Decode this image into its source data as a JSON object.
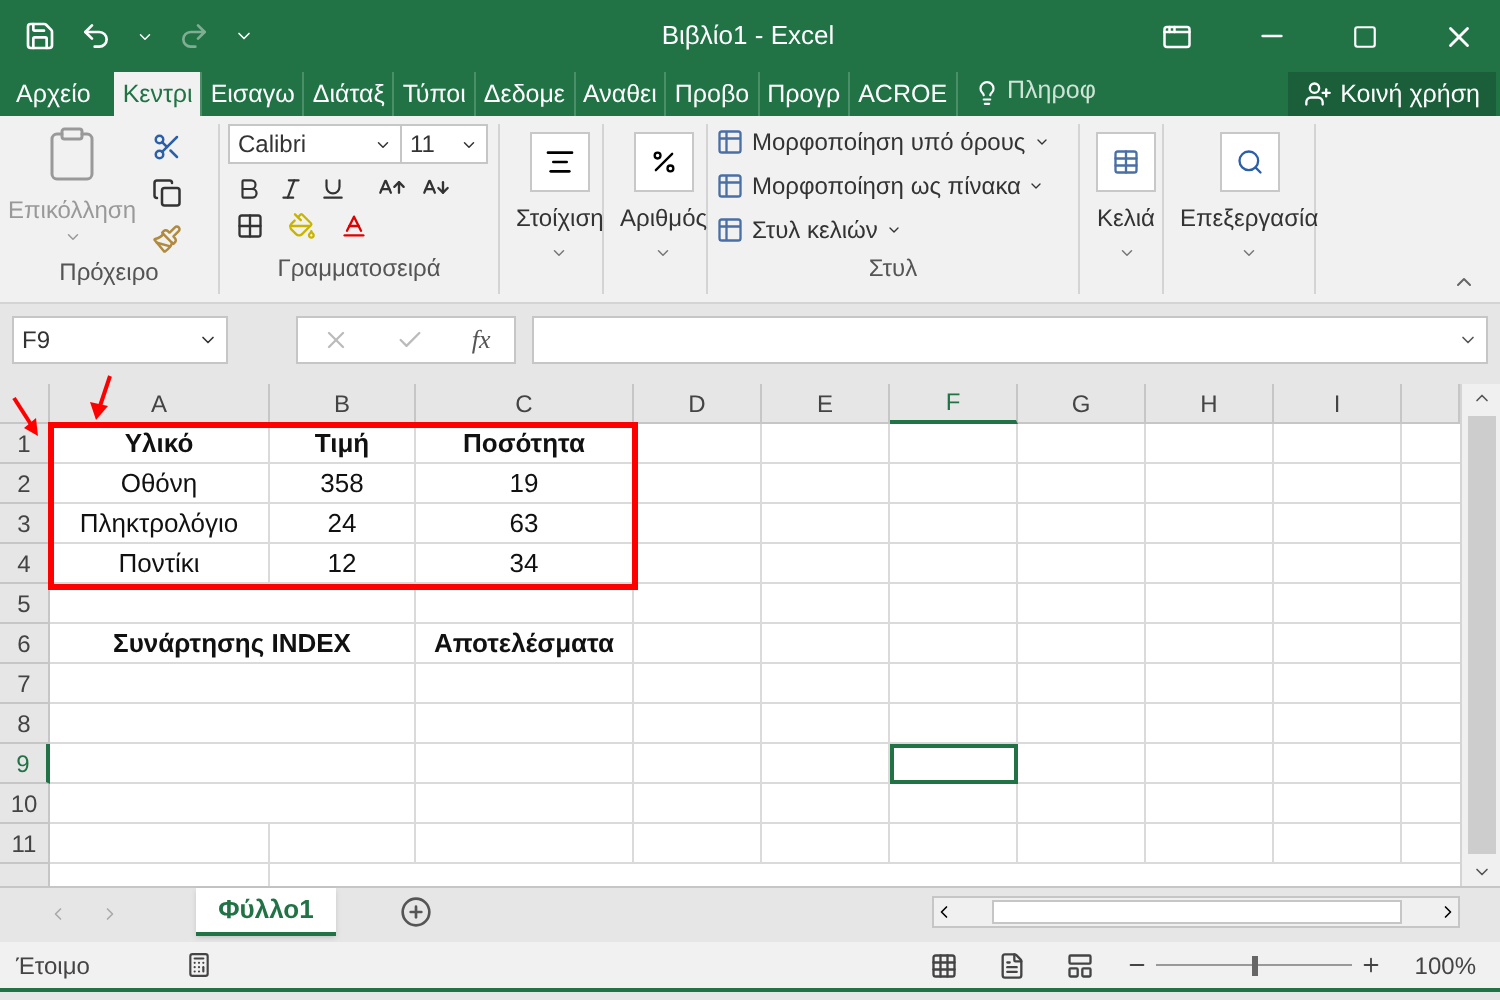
{
  "title_bar": {
    "title": "Βιβλίο1 - Excel"
  },
  "ribbon_tabs": [
    {
      "label": "Αρχείο",
      "kind": "file",
      "selected": false
    },
    {
      "label": "Κεντρι",
      "kind": "tab",
      "selected": true
    },
    {
      "label": "Εισαγω",
      "kind": "tab",
      "selected": false
    },
    {
      "label": "Διάταξ",
      "kind": "tab",
      "selected": false
    },
    {
      "label": "Τύποι",
      "kind": "tab",
      "selected": false
    },
    {
      "label": "Δεδομε",
      "kind": "tab",
      "selected": false
    },
    {
      "label": "Αναθει",
      "kind": "tab",
      "selected": false
    },
    {
      "label": "Προβο",
      "kind": "tab",
      "selected": false
    },
    {
      "label": "Προγρ",
      "kind": "tab",
      "selected": false
    },
    {
      "label": "ACROE",
      "kind": "tab",
      "selected": false
    }
  ],
  "tell_me": "Πληροφ",
  "share": "Κοινή χρήση",
  "clipboard": {
    "paste": "Επικόλληση",
    "paste_disabled": true,
    "label": "Πρόχειρο"
  },
  "font": {
    "name": "Calibri",
    "size": "11",
    "label": "Γραμματοσειρά"
  },
  "alignment": {
    "label": "Στοίχιση"
  },
  "number": {
    "label": "Αριθμός"
  },
  "styles": {
    "items": [
      "Μορφοποίηση υπό όρους",
      "Μορφοποίηση ως πίνακα",
      "Στυλ κελιών"
    ],
    "label": "Στυλ"
  },
  "cells": {
    "label": "Κελιά"
  },
  "editing": {
    "label": "Επεξεργασία"
  },
  "name_box": "F9",
  "function_label": "fx",
  "columns": [
    {
      "label": "A",
      "selected": false
    },
    {
      "label": "B",
      "selected": false
    },
    {
      "label": "C",
      "selected": false
    },
    {
      "label": "D",
      "selected": false
    },
    {
      "label": "E",
      "selected": false
    },
    {
      "label": "F",
      "selected": true
    },
    {
      "label": "G",
      "selected": false
    },
    {
      "label": "H",
      "selected": false
    },
    {
      "label": "I",
      "selected": false
    }
  ],
  "rows": [
    {
      "label": "1",
      "selected": false,
      "merged": false,
      "cells": [
        {
          "text": "Υλικό",
          "bold": true
        },
        {
          "text": "Τιμή",
          "bold": true
        },
        {
          "text": "Ποσότητα",
          "bold": true
        }
      ]
    },
    {
      "label": "2",
      "selected": false,
      "merged": false,
      "cells": [
        {
          "text": "Οθόνη",
          "bold": false
        },
        {
          "text": "358",
          "bold": false
        },
        {
          "text": "19",
          "bold": false
        }
      ]
    },
    {
      "label": "3",
      "selected": false,
      "merged": false,
      "cells": [
        {
          "text": "Πληκτρολόγιο",
          "bold": false
        },
        {
          "text": "24",
          "bold": false
        },
        {
          "text": "63",
          "bold": false
        }
      ]
    },
    {
      "label": "4",
      "selected": false,
      "merged": false,
      "cells": [
        {
          "text": "Ποντίκι",
          "bold": false
        },
        {
          "text": "12",
          "bold": false
        },
        {
          "text": "34",
          "bold": false
        }
      ]
    },
    {
      "label": "5",
      "selected": false,
      "merged": true
    },
    {
      "label": "6",
      "selected": false,
      "merged": true,
      "cells": [
        {
          "text": "Συνάρτησης INDEX",
          "bold": true
        },
        {
          "text": "Αποτελέσματα",
          "bold": true
        }
      ]
    },
    {
      "label": "7",
      "selected": false,
      "merged": true
    },
    {
      "label": "8",
      "selected": false,
      "merged": true
    },
    {
      "label": "9",
      "selected": true,
      "merged": true
    },
    {
      "label": "10",
      "selected": false,
      "merged": true
    },
    {
      "label": "11",
      "selected": false,
      "merged": false
    }
  ],
  "zoom_slider": {
    "level": 0.5
  },
  "sheet_tabs": [
    {
      "label": "Φύλλο1",
      "selected": true
    }
  ],
  "status": "Έτοιμο",
  "zoom": "100%"
}
